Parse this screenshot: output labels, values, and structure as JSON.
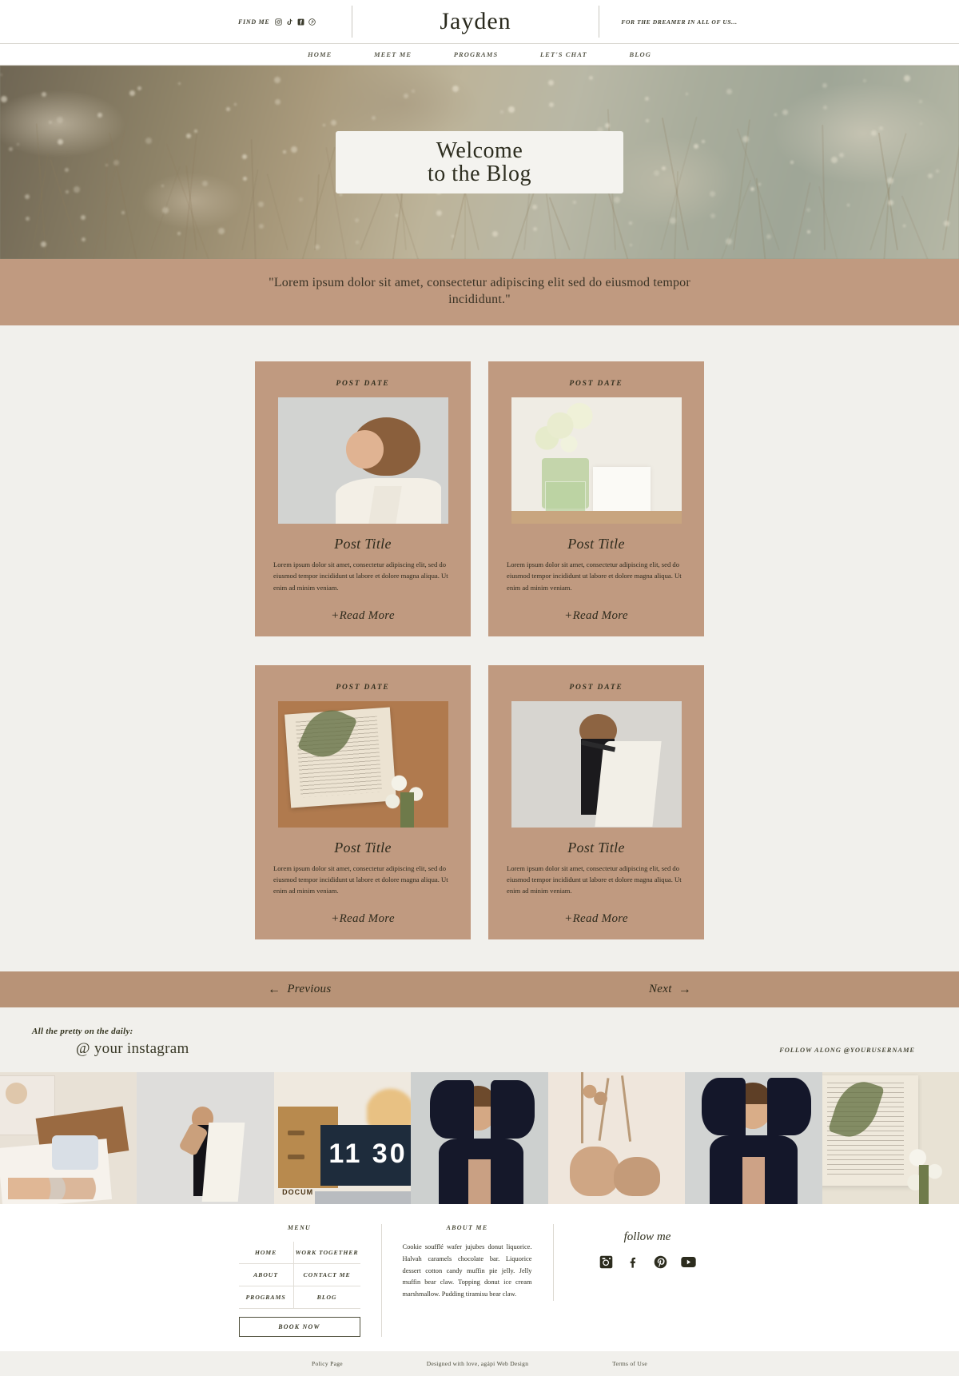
{
  "header": {
    "find_me_label": "FIND ME",
    "brand": "Jayden",
    "tagline": "FOR THE DREAMER IN ALL OF US...",
    "social_icons": [
      "instagram-icon",
      "tiktok-icon",
      "facebook-icon",
      "pinterest-icon"
    ]
  },
  "nav": {
    "items": [
      {
        "label": "HOME"
      },
      {
        "label": "MEET ME"
      },
      {
        "label": "PROGRAMS"
      },
      {
        "label": "LET'S CHAT"
      },
      {
        "label": "BLOG"
      }
    ]
  },
  "hero": {
    "line1": "Welcome",
    "line2": "to the Blog"
  },
  "quote": {
    "text": "\"Lorem ipsum dolor sit amet, consectetur adipiscing elit sed do eiusmod tempor incididunt.\""
  },
  "posts": {
    "read_more_label": "+Read More",
    "items": [
      {
        "date": "POST DATE",
        "title": "Post Title",
        "excerpt": "Lorem ipsum dolor sit amet, consectetur adipiscing elit, sed do eiusmod tempor incididunt ut labore et dolore magna aliqua. Ut enim ad minim veniam.",
        "image": "woman-white-blazer-profile"
      },
      {
        "date": "POST DATE",
        "title": "Post Title",
        "excerpt": "Lorem ipsum dolor sit amet, consectetur adipiscing elit, sed do eiusmod tempor incididunt ut labore et dolore magna aliqua. Ut enim ad minim veniam.",
        "image": "lily-of-the-valley-vase"
      },
      {
        "date": "POST DATE",
        "title": "Post Title",
        "excerpt": "Lorem ipsum dolor sit amet, consectetur adipiscing elit, sed do eiusmod tempor incididunt ut labore et dolore magna aliqua. Ut enim ad minim veniam.",
        "image": "open-book-pressed-ferns"
      },
      {
        "date": "POST DATE",
        "title": "Post Title",
        "excerpt": "Lorem ipsum dolor sit amet, consectetur adipiscing elit, sed do eiusmod tempor incididunt ut labore et dolore magna aliqua. Ut enim ad minim veniam.",
        "image": "woman-white-cape-back"
      }
    ]
  },
  "pagination": {
    "previous_label": "Previous",
    "next_label": "Next",
    "previous_arrow": "←",
    "next_arrow": "→"
  },
  "instagram": {
    "script_line": "All the pretty on the daily:",
    "handle": "@ your instagram",
    "follow_along": "FOLLOW ALONG @YOURUSERNAME",
    "tiles": [
      "desk-flatlay-color-palette",
      "woman-white-coat-studio",
      "flip-clock-11-30-laptop",
      "woman-navy-blazer-hands-up",
      "beige-vases-dried-stems",
      "woman-navy-blazer-smiling",
      "book-ferns-white-flowers"
    ]
  },
  "footer": {
    "menu_heading": "MENU",
    "menu_items": [
      "HOME",
      "WORK TOGETHER",
      "ABOUT",
      "CONTACT ME",
      "PROGRAMS",
      "BLOG"
    ],
    "book_now_label": "BOOK NOW",
    "about_heading": "ABOUT ME",
    "about_text": "Cookie soufflé wafer jujubes donut liquorice. Halvah caramels chocolate bar. Liquorice dessert cotton candy muffin pie jelly. Jelly muffin bear claw. Topping donut ice cream marshmallow. Pudding tiramisu bear claw.",
    "follow_heading": "follow me",
    "social_icons": [
      "instagram-icon",
      "facebook-icon",
      "pinterest-icon",
      "youtube-icon"
    ]
  },
  "bottom_bar": {
    "policy": "Policy Page",
    "credit": "Designed with love, agápi Web Design",
    "terms": "Terms of Use"
  },
  "colors": {
    "tan": "#c09a80",
    "tan_dark": "#b89377",
    "cream": "#f1f0ec",
    "ink": "#2e2a1c"
  }
}
